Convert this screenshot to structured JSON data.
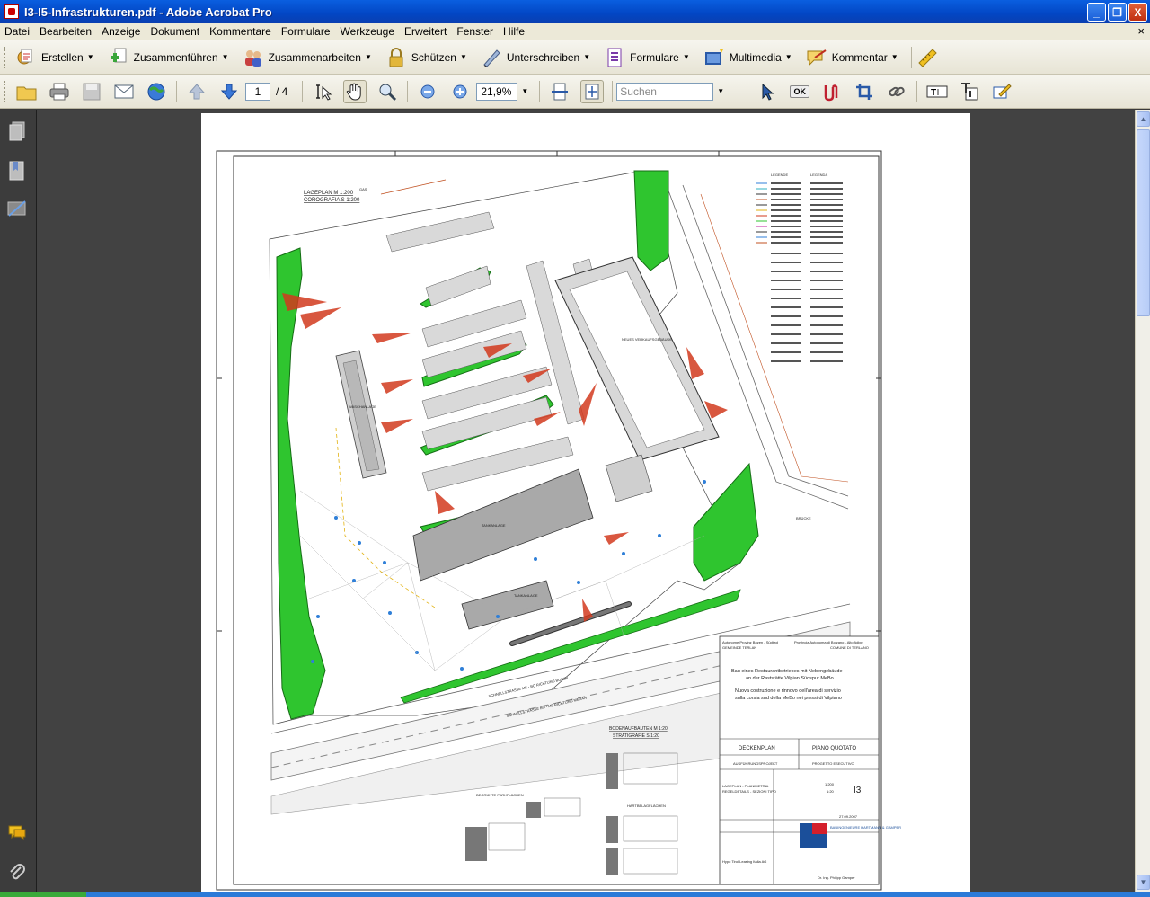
{
  "window": {
    "title": "I3-I5-Infrastrukturen.pdf - Adobe Acrobat Pro",
    "minimize": "_",
    "maximize": "❐",
    "close": "X"
  },
  "menu": {
    "items": [
      "Datei",
      "Bearbeiten",
      "Anzeige",
      "Dokument",
      "Kommentare",
      "Formulare",
      "Werkzeuge",
      "Erweitert",
      "Fenster",
      "Hilfe"
    ],
    "close_glyph": "×"
  },
  "tasks": [
    {
      "label": "Erstellen",
      "icon": "create-pdf-icon"
    },
    {
      "label": "Zusammenführen",
      "icon": "combine-icon"
    },
    {
      "label": "Zusammenarbeiten",
      "icon": "collaborate-icon"
    },
    {
      "label": "Schützen",
      "icon": "lock-icon"
    },
    {
      "label": "Unterschreiben",
      "icon": "pen-icon"
    },
    {
      "label": "Formulare",
      "icon": "form-icon"
    },
    {
      "label": "Multimedia",
      "icon": "multimedia-icon"
    },
    {
      "label": "Kommentar",
      "icon": "comment-icon"
    }
  ],
  "toolbar": {
    "page_current": "1",
    "page_total": "/ 4",
    "zoom": "21,9%",
    "search_placeholder": "Suchen",
    "ok_label": "OK"
  },
  "drawing": {
    "lageplan_title": "LAGEPLAN  M 1:200",
    "corografia_title": "COROGRAFIA  S 1:200",
    "legende_de": "LEGENDE",
    "legenda_it": "LEGENDA",
    "neues_verkaufsgebaeude": "NEUES VERKAUFSGEBÄUDE",
    "waschanlage": "WASCHANLAGE",
    "tankanlage": "TANKANLAGE",
    "tankanlage2": "TANKANLAGE",
    "schnellstrasse_bozen": "SCHNELLSTRASSE ME - BO RICHTUNG BOZEN",
    "schnellstrasse_meran": "SCHNELLSTRASSE BO - ME RICHTUNG MERAN",
    "bodenaufbauten": "BODENAUFBAUTEN  M 1:20",
    "stratigrafie": "STRATIGRAFIE  S 1:20",
    "begruente": "BEGRÜNTE PARKFLÄCHEN",
    "hartbelag": "HARTBELAGFLÄCHEN",
    "gas_label": "GAS",
    "bruecke": "BRÜCKE"
  },
  "titleblock": {
    "prov_de": "Autonome Provinz Bozen - Südtirol",
    "gem_de": "GEMEINDE TERLAN",
    "prov_it": "Provincia Autonoma di Bolzano - Alto Adige",
    "gem_it": "COMUNE DI TERLANO",
    "desc_de_1": "Bau eines Restaurantbetriebes mit Nebengebäude",
    "desc_de_2": "an der Raststätte Vilpian Südspur MeBo",
    "desc_it_1": "Nuova costruzione e rinnovo dell'area di servizio",
    "desc_it_2": "sulla corsia sud della MeBo nei pressi di Vilpiano",
    "plan_de": "DECKENPLAN",
    "plan_it": "PIANO QUOTATO",
    "phase_de": "AUSFÜHRUNGSPROJEKT",
    "phase_it": "PROGETTO ESECUTIVO",
    "content_1": "LAGEPLAN - PLANIMETRIA",
    "content_2": "REGELDETAILS - SEZIONI TIPO",
    "scale_1": "1:200",
    "scale_2": "1:20",
    "plan_no": "I3",
    "date": "27.09.2007",
    "firm": "BAUINGENIEURE HARTMANN & GAMPER",
    "signature": "Dr. Ing. Philipp Gamper",
    "client": "Hypo Tirol Leasing Italia AG"
  },
  "colors": {
    "title_bar": "#0246c4",
    "menu_bg": "#ece9d8",
    "green_area": "#2fc52f",
    "red_marks": "#d23a1e",
    "gray_roof": "#9a9a9a",
    "doc_bg": "#424242"
  }
}
